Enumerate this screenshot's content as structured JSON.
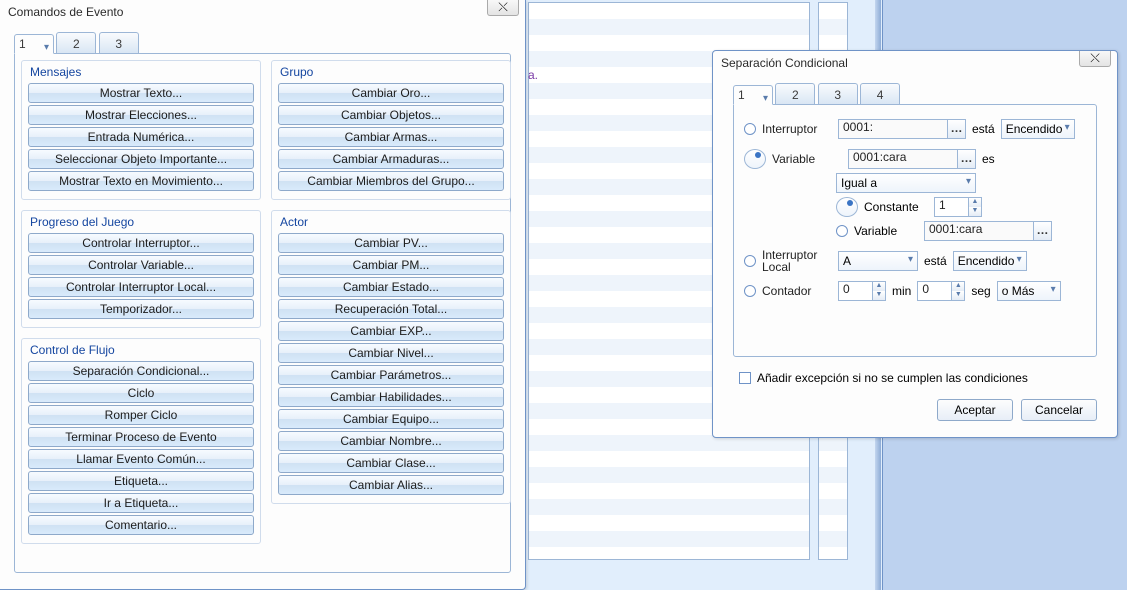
{
  "bg_panel_text": "a.",
  "event_cmds": {
    "title": "Comandos de Evento",
    "close_glyph": "⤬",
    "tabs": [
      "1",
      "2",
      "3"
    ],
    "tab_selected": 0,
    "groups_left": [
      {
        "title": "Mensajes",
        "items": [
          "Mostrar Texto...",
          "Mostrar Elecciones...",
          "Entrada Numérica...",
          "Seleccionar Objeto Importante...",
          "Mostrar Texto en Movimiento..."
        ]
      },
      {
        "title": "Progreso del Juego",
        "items": [
          "Controlar Interruptor...",
          "Controlar Variable...",
          "Controlar Interruptor Local...",
          "Temporizador..."
        ]
      },
      {
        "title": "Control de Flujo",
        "items": [
          "Separación Condicional...",
          "Ciclo",
          "Romper Ciclo",
          "Terminar Proceso de Evento",
          "Llamar Evento Común...",
          "Etiqueta...",
          "Ir a Etiqueta...",
          "Comentario..."
        ]
      }
    ],
    "groups_right": [
      {
        "title": "Grupo",
        "items": [
          "Cambiar Oro...",
          "Cambiar Objetos...",
          "Cambiar Armas...",
          "Cambiar Armaduras...",
          "Cambiar Miembros del Grupo..."
        ]
      },
      {
        "title": "Actor",
        "items": [
          "Cambiar PV...",
          "Cambiar PM...",
          "Cambiar Estado...",
          "Recuperación Total...",
          "Cambiar EXP...",
          "Cambiar Nivel...",
          "Cambiar Parámetros...",
          "Cambiar Habilidades...",
          "Cambiar Equipo...",
          "Cambiar Nombre...",
          "Cambiar Clase...",
          "Cambiar Alias..."
        ]
      }
    ]
  },
  "cond": {
    "title": "Separación Condicional",
    "close_glyph": "⤬",
    "tabs": [
      "1",
      "2",
      "3",
      "4"
    ],
    "tab_selected": 0,
    "radio_selected": "variable",
    "switch": {
      "label": "Interruptor",
      "value": "0001:",
      "is_label": "está",
      "state": "Encendido"
    },
    "variable": {
      "label": "Variable",
      "value": "0001:cara",
      "is_label": "es",
      "op": "Igual a",
      "constant_label": "Constante",
      "constant_value": "1",
      "varref_label": "Variable",
      "varref_value": "0001:cara",
      "sub_selected": "constant"
    },
    "self_switch": {
      "label": "Interruptor Local",
      "value": "A",
      "is_label": "está",
      "state": "Encendido"
    },
    "timer": {
      "label": "Contador",
      "min": "0",
      "min_label": "min",
      "sec": "0",
      "sec_label": "seg",
      "cmp": "o Más"
    },
    "else_checkbox": "Añadir excepción si no se cumplen las condiciones",
    "ok": "Aceptar",
    "cancel": "Cancelar"
  }
}
